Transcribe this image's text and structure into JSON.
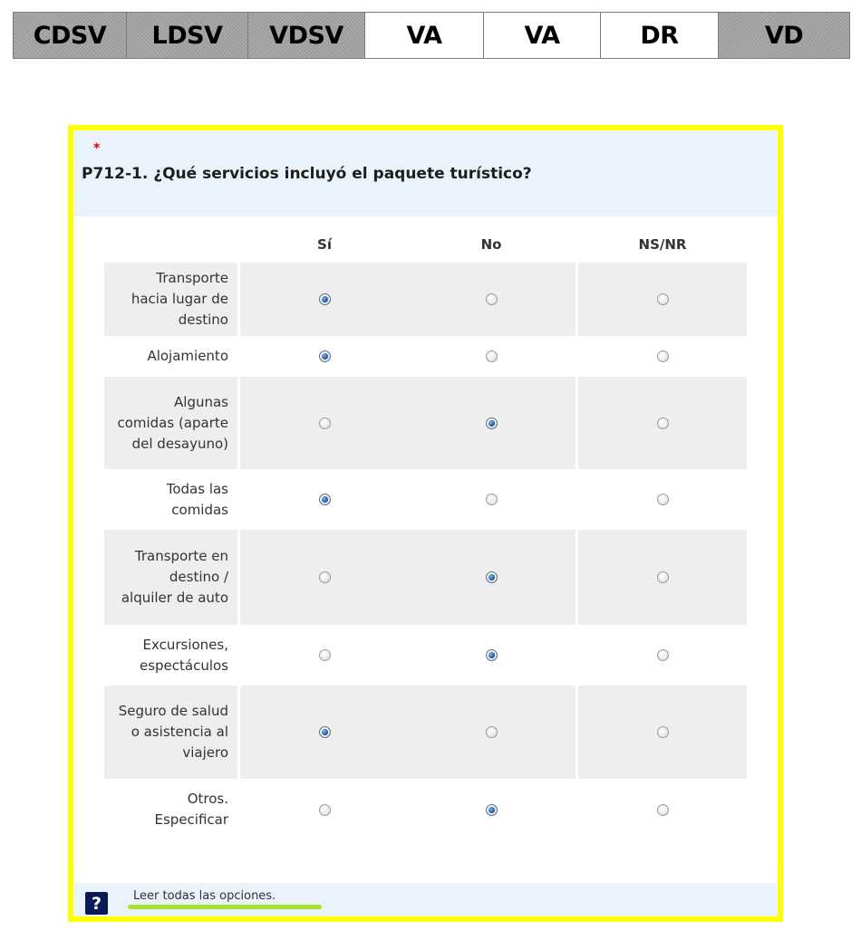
{
  "tabs": [
    {
      "label": "CDSV",
      "style": "dark"
    },
    {
      "label": "LDSV",
      "style": "dark"
    },
    {
      "label": "VDSV",
      "style": "dark"
    },
    {
      "label": "VA",
      "style": "light"
    },
    {
      "label": "VA",
      "style": "light"
    },
    {
      "label": "DR",
      "style": "light"
    },
    {
      "label": "VD",
      "style": "dark"
    }
  ],
  "question": {
    "required_marker": "*",
    "text": "P712-1. ¿Qué servicios incluyó el paquete turístico?",
    "columns": [
      "Sí",
      "No",
      "NS/NR"
    ],
    "rows": [
      {
        "label": "Transporte hacia lugar de destino",
        "selected": "Sí"
      },
      {
        "label": "Alojamiento",
        "selected": "Sí"
      },
      {
        "label": "Algunas comidas (aparte del desayuno)",
        "selected": "No"
      },
      {
        "label": "Todas las comidas",
        "selected": "Sí"
      },
      {
        "label": "Transporte en destino / alquiler de auto",
        "selected": "No"
      },
      {
        "label": "Excursiones, espectáculos",
        "selected": "No"
      },
      {
        "label": "Seguro de salud o asistencia al viajero",
        "selected": "Sí"
      },
      {
        "label": "Otros. Especificar",
        "selected": "No"
      }
    ]
  },
  "help": {
    "icon": "question-mark-icon",
    "text": "Leer todas las opciones."
  },
  "colors": {
    "panel_border": "#ffff00",
    "header_bg": "#eaf2fb",
    "row_shade": "#eeeeee",
    "required": "#e00000",
    "highlight": "#a6e22e"
  }
}
